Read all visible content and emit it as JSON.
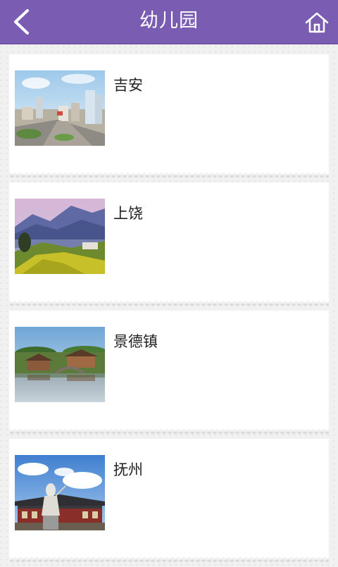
{
  "header": {
    "title": "幼儿园",
    "back_icon": "chevron-left-icon",
    "home_icon": "home-icon",
    "color": "#7a5db3"
  },
  "cities": [
    {
      "name": "吉安"
    },
    {
      "name": "上饶"
    },
    {
      "name": "景德镇"
    },
    {
      "name": "抚州"
    }
  ]
}
